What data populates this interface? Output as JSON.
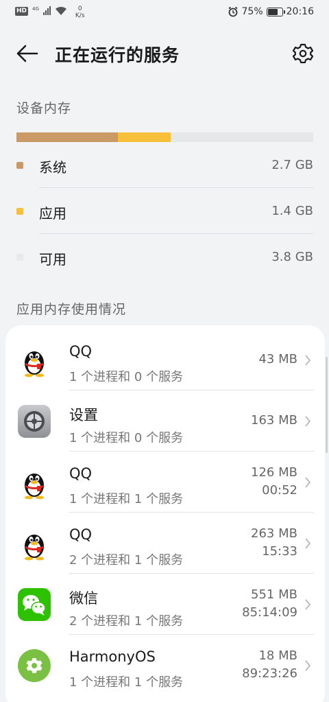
{
  "status_bar": {
    "hd": "HD",
    "network": "4G",
    "speed_value": "0",
    "speed_unit": "K/s",
    "battery_percent": "75%",
    "battery_level": 0.75,
    "time": "20:16"
  },
  "header": {
    "title": "正在运行的服务"
  },
  "memory": {
    "section_title": "设备内存",
    "bar": [
      {
        "label": "系统",
        "value_gb": 2.7,
        "color": "#c99966"
      },
      {
        "label": "应用",
        "value_gb": 1.4,
        "color": "#f7bf3a"
      },
      {
        "label": "可用",
        "value_gb": 3.8,
        "color": "#e6e7e9"
      }
    ],
    "legend": [
      {
        "label": "系统",
        "value": "2.7 GB",
        "color": "#c99966"
      },
      {
        "label": "应用",
        "value": "1.4 GB",
        "color": "#f7bf3a"
      },
      {
        "label": "可用",
        "value": "3.8 GB",
        "color": "#e8e9eb"
      }
    ]
  },
  "apps_section_title": "应用内存使用情况",
  "apps": [
    {
      "name": "QQ",
      "sub": "1 个进程和 0 个服务",
      "meta1": "43 MB",
      "meta2": "",
      "icon": "qq-icon"
    },
    {
      "name": "设置",
      "sub": "1 个进程和 0 个服务",
      "meta1": "163 MB",
      "meta2": "",
      "icon": "settings-app-icon"
    },
    {
      "name": "QQ",
      "sub": "1 个进程和 1 个服务",
      "meta1": "126 MB",
      "meta2": "00:52",
      "icon": "qq-icon"
    },
    {
      "name": "QQ",
      "sub": "2 个进程和 1 个服务",
      "meta1": "263 MB",
      "meta2": "15:33",
      "icon": "qq-icon"
    },
    {
      "name": "微信",
      "sub": "2 个进程和 1 个服务",
      "meta1": "551 MB",
      "meta2": "85:14:09",
      "icon": "wechat-icon"
    },
    {
      "name": "HarmonyOS",
      "sub": "1 个进程和 1 个服务",
      "meta1": "18 MB",
      "meta2": "89:23:26",
      "icon": "harmonyos-icon"
    }
  ]
}
